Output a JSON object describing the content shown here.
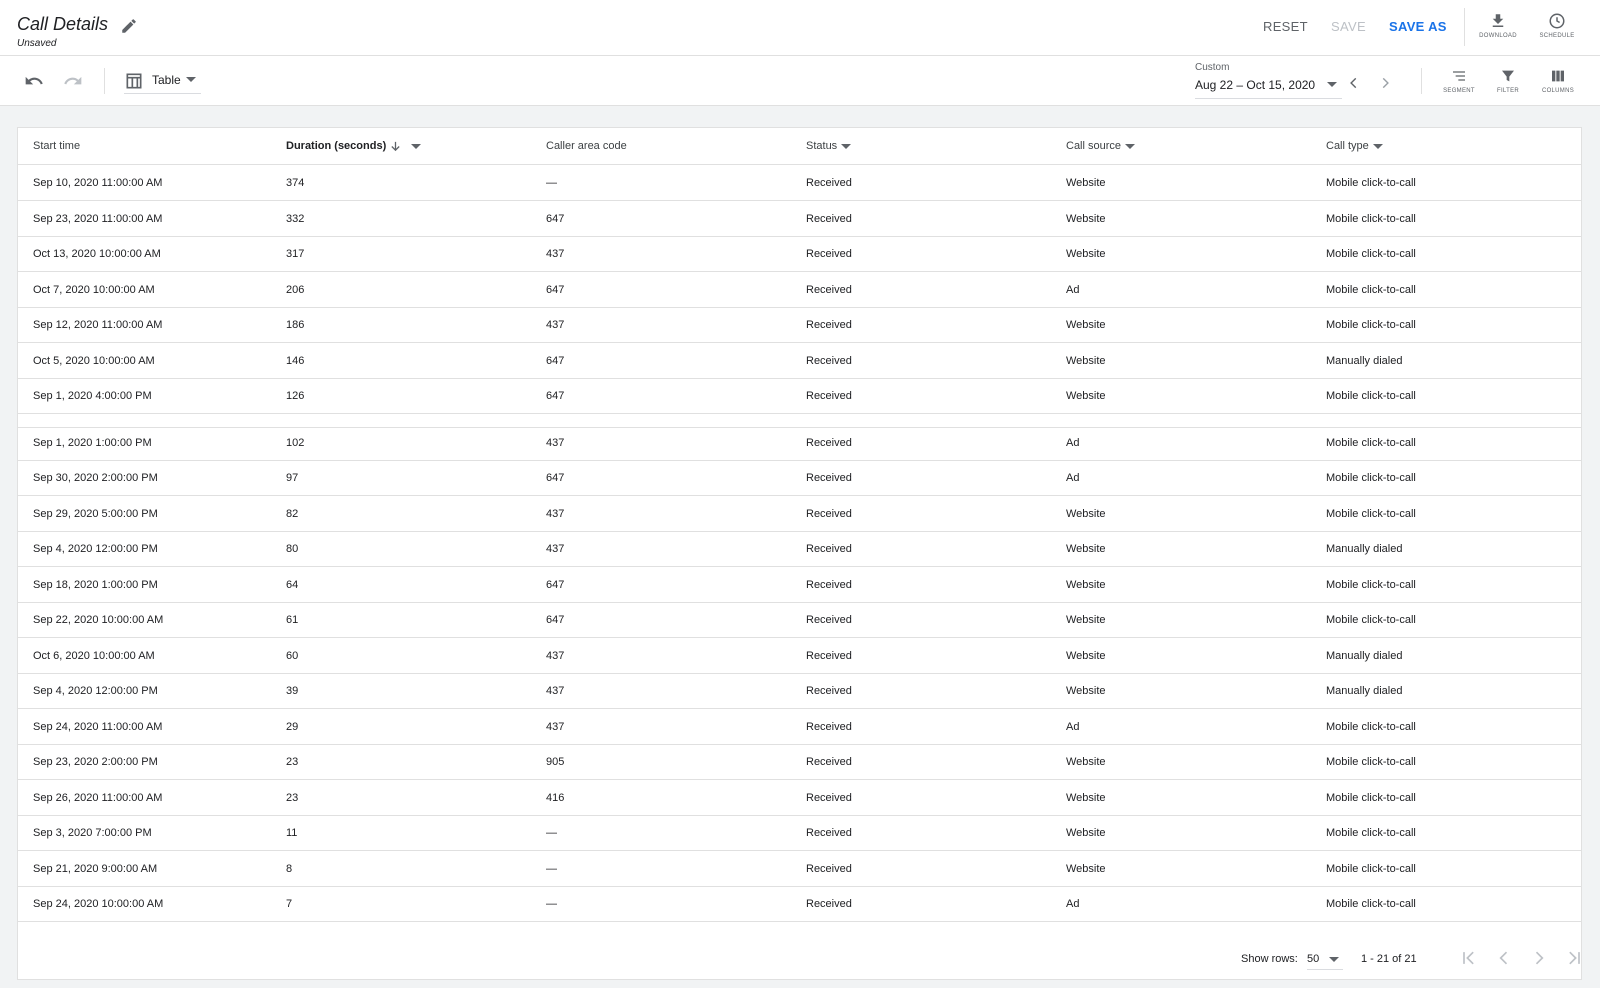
{
  "header": {
    "title": "Call Details",
    "subtitle": "Unsaved",
    "reset_label": "RESET",
    "save_label": "SAVE",
    "save_as_label": "SAVE AS",
    "download_label": "DOWNLOAD",
    "schedule_label": "SCHEDULE"
  },
  "toolbar": {
    "view_label": "Table",
    "date_label": "Custom",
    "date_value": "Aug 22 – Oct 15, 2020",
    "segment_label": "SEGMENT",
    "filter_label": "FILTER",
    "columns_label": "COLUMNS"
  },
  "table": {
    "columns": [
      "Start time",
      "Duration (seconds)",
      "Caller area code",
      "Status",
      "Call source",
      "Call type"
    ],
    "rows": [
      [
        "Sep 10, 2020 11:00:00 AM",
        "374",
        "—",
        "Received",
        "Website",
        "Mobile click-to-call"
      ],
      [
        "Sep 23, 2020 11:00:00 AM",
        "332",
        "647",
        "Received",
        "Website",
        "Mobile click-to-call"
      ],
      [
        "Oct 13, 2020 10:00:00 AM",
        "317",
        "437",
        "Received",
        "Website",
        "Mobile click-to-call"
      ],
      [
        "Oct 7, 2020 10:00:00 AM",
        "206",
        "647",
        "Received",
        "Ad",
        "Mobile click-to-call"
      ],
      [
        "Sep 12, 2020 11:00:00 AM",
        "186",
        "437",
        "Received",
        "Website",
        "Mobile click-to-call"
      ],
      [
        "Oct 5, 2020 10:00:00 AM",
        "146",
        "647",
        "Received",
        "Website",
        "Manually dialed"
      ],
      [
        "Sep 1, 2020 4:00:00 PM",
        "126",
        "647",
        "Received",
        "Website",
        "Mobile click-to-call"
      ],
      [
        "Sep 1, 2020 1:00:00 PM",
        "102",
        "437",
        "Received",
        "Ad",
        "Mobile click-to-call"
      ],
      [
        "Sep 30, 2020 2:00:00 PM",
        "97",
        "647",
        "Received",
        "Ad",
        "Mobile click-to-call"
      ],
      [
        "Sep 29, 2020 5:00:00 PM",
        "82",
        "437",
        "Received",
        "Website",
        "Mobile click-to-call"
      ],
      [
        "Sep 4, 2020 12:00:00 PM",
        "80",
        "437",
        "Received",
        "Website",
        "Manually dialed"
      ],
      [
        "Sep 18, 2020 1:00:00 PM",
        "64",
        "647",
        "Received",
        "Website",
        "Mobile click-to-call"
      ],
      [
        "Sep 22, 2020 10:00:00 AM",
        "61",
        "647",
        "Received",
        "Website",
        "Mobile click-to-call"
      ],
      [
        "Oct 6, 2020 10:00:00 AM",
        "60",
        "437",
        "Received",
        "Website",
        "Manually dialed"
      ],
      [
        "Sep 4, 2020 12:00:00 PM",
        "39",
        "437",
        "Received",
        "Website",
        "Manually dialed"
      ],
      [
        "Sep 24, 2020 11:00:00 AM",
        "29",
        "437",
        "Received",
        "Ad",
        "Mobile click-to-call"
      ],
      [
        "Sep 23, 2020 2:00:00 PM",
        "23",
        "905",
        "Received",
        "Website",
        "Mobile click-to-call"
      ],
      [
        "Sep 26, 2020 11:00:00 AM",
        "23",
        "416",
        "Received",
        "Website",
        "Mobile click-to-call"
      ],
      [
        "Sep 3, 2020 7:00:00 PM",
        "11",
        "—",
        "Received",
        "Website",
        "Mobile click-to-call"
      ],
      [
        "Sep 21, 2020 9:00:00 AM",
        "8",
        "—",
        "Received",
        "Website",
        "Mobile click-to-call"
      ],
      [
        "Sep 24, 2020 10:00:00 AM",
        "7",
        "—",
        "Received",
        "Ad",
        "Mobile click-to-call"
      ]
    ]
  },
  "footer": {
    "rows_label": "Show rows:",
    "rows_value": "50",
    "range_text": "1 - 21 of 21"
  },
  "colors": {
    "accent": "#1a73e8",
    "disabled": "#bdc1c6",
    "icon": "#5f6368"
  }
}
